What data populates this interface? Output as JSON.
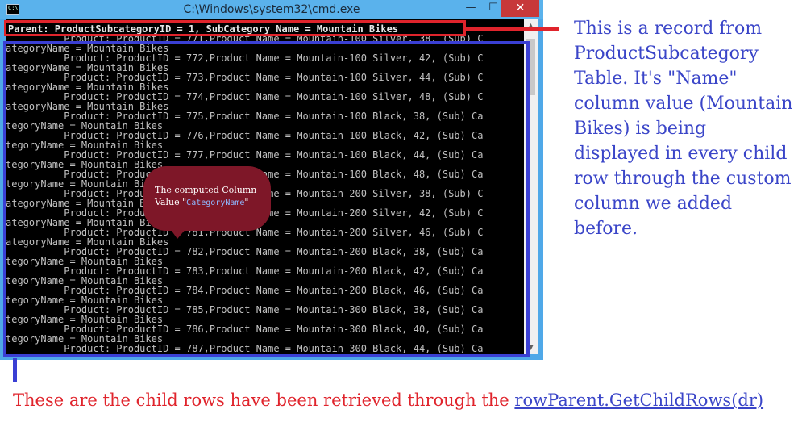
{
  "window": {
    "title": "C:\\Windows\\system32\\cmd.exe",
    "minimize_glyph": "—",
    "maximize_glyph": "☐",
    "close_glyph": "✕",
    "frame_color": "#4fa8e8",
    "close_color": "#c7383a"
  },
  "console": {
    "parent_line": "Parent: ProductSubcategoryID = 1, SubCategory Name = Mountain Bikes",
    "lines": [
      "          Product: ProductID = 771,Product Name = Mountain-100 Silver, 38, (Sub) C",
      "ategoryName = Mountain Bikes",
      "          Product: ProductID = 772,Product Name = Mountain-100 Silver, 42, (Sub) C",
      "ategoryName = Mountain Bikes",
      "          Product: ProductID = 773,Product Name = Mountain-100 Silver, 44, (Sub) C",
      "ategoryName = Mountain Bikes",
      "          Product: ProductID = 774,Product Name = Mountain-100 Silver, 48, (Sub) C",
      "ategoryName = Mountain Bikes",
      "          Product: ProductID = 775,Product Name = Mountain-100 Black, 38, (Sub) Ca",
      "tegoryName = Mountain Bikes",
      "          Product: ProductID = 776,Product Name = Mountain-100 Black, 42, (Sub) Ca",
      "tegoryName = Mountain Bikes",
      "          Product: ProductID = 777,Product Name = Mountain-100 Black, 44, (Sub) Ca",
      "tegoryName = Mountain Bikes",
      "          Product: ProductID = 778,Product Name = Mountain-100 Black, 48, (Sub) Ca",
      "tegoryName = Mountain Bikes",
      "          Product: ProductID = 779,Product Name = Mountain-200 Silver, 38, (Sub) C",
      "ategoryName = Mountain Bikes",
      "          Product: ProductID = 780,Product Name = Mountain-200 Silver, 42, (Sub) C",
      "ategoryName = Mountain Bikes",
      "          Product: ProductID = 781,Product Name = Mountain-200 Silver, 46, (Sub) C",
      "ategoryName = Mountain Bikes",
      "          Product: ProductID = 782,Product Name = Mountain-200 Black, 38, (Sub) Ca",
      "tegoryName = Mountain Bikes",
      "          Product: ProductID = 783,Product Name = Mountain-200 Black, 42, (Sub) Ca",
      "tegoryName = Mountain Bikes",
      "          Product: ProductID = 784,Product Name = Mountain-200 Black, 46, (Sub) Ca",
      "tegoryName = Mountain Bikes",
      "          Product: ProductID = 785,Product Name = Mountain-300 Black, 38, (Sub) Ca",
      "tegoryName = Mountain Bikes",
      "          Product: ProductID = 786,Product Name = Mountain-300 Black, 40, (Sub) Ca",
      "tegoryName = Mountain Bikes",
      "          Product: ProductID = 787,Product Name = Mountain-300 Black, 44, (Sub) Ca"
    ],
    "text_color": "#c0c0c0",
    "background": "#000000"
  },
  "callout": {
    "text_prefix": "The computed Column Value \"",
    "code": "CategoryName",
    "text_suffix": "\"",
    "color": "#7e1728"
  },
  "annotations": {
    "right_text": "This is a record from ProductSubcategory Table. It's \"Name\" column value (Mountain Bikes) is being displayed in every child row through the custom column we added before.",
    "bottom_text": "These are the child rows have been retrieved through the ",
    "bottom_link": "rowParent.GetChildRows(dr)",
    "red_color": "#e0242c",
    "blue_color": "#3a45c8"
  }
}
